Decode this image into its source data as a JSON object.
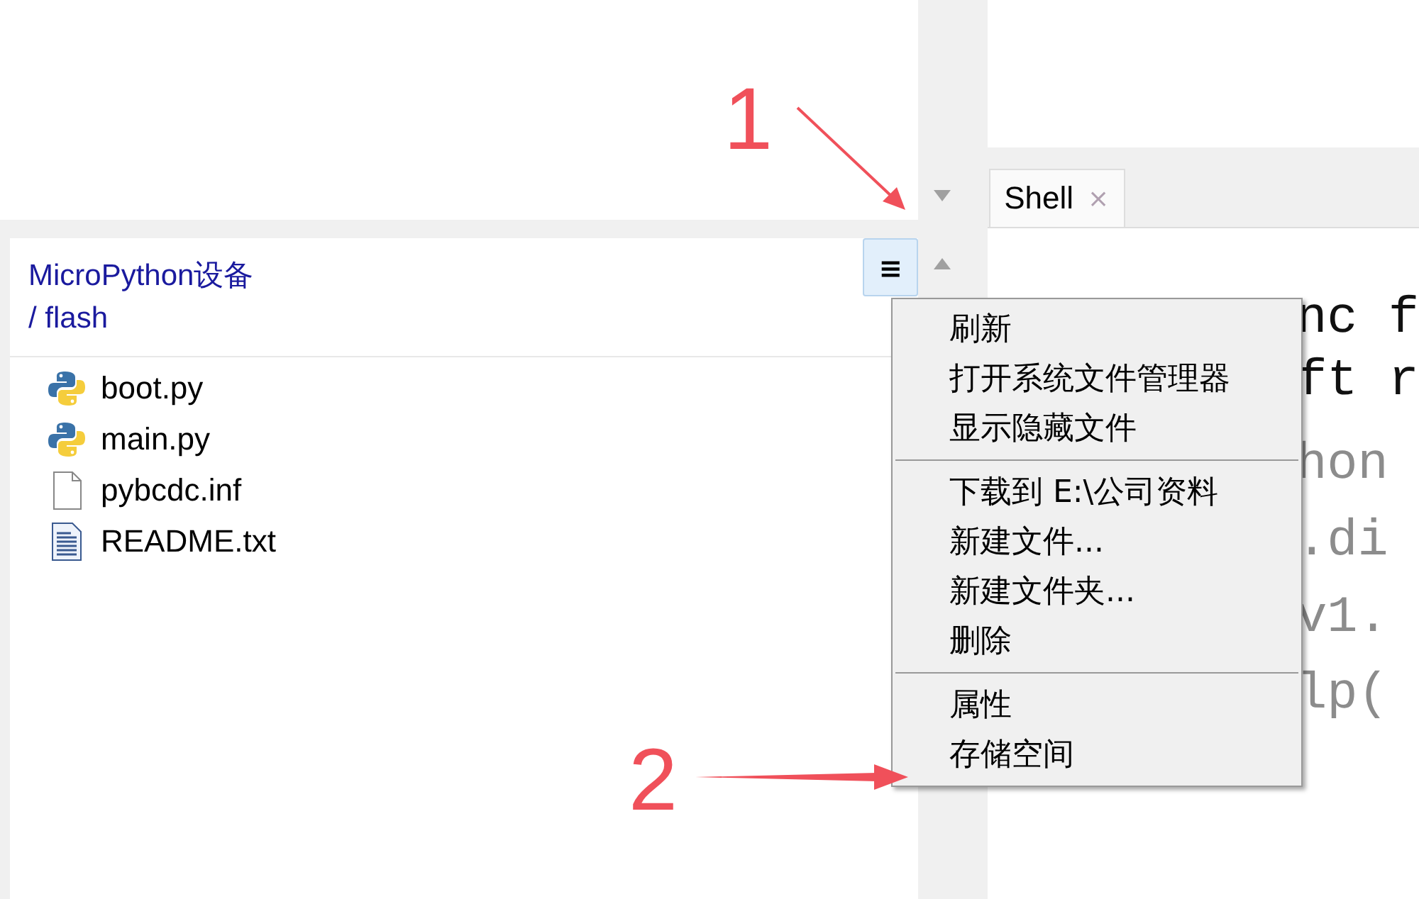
{
  "files_panel": {
    "device": "MicroPython设备",
    "path": "/ flash",
    "files": [
      {
        "name": "boot.py",
        "kind": "python"
      },
      {
        "name": "main.py",
        "kind": "python"
      },
      {
        "name": "pybcdc.inf",
        "kind": "blank"
      },
      {
        "name": "README.txt",
        "kind": "text"
      }
    ],
    "menu_button": {
      "label": "≡",
      "selected": true
    }
  },
  "shell": {
    "tab": {
      "label": "Shell",
      "close": "×"
    },
    "lines": [
      {
        "text": "nc f",
        "dim": false
      },
      {
        "text": "ft r",
        "dim": false
      },
      {
        "text": "hon",
        "dim": true
      },
      {
        "text": ".di",
        "dim": true
      },
      {
        "text": "v1.",
        "dim": true
      },
      {
        "text": "lp(",
        "dim": true
      }
    ]
  },
  "context_menu": {
    "groups": [
      [
        "刷新",
        "打开系统文件管理器",
        "显示隐藏文件"
      ],
      [
        "下载到 E:\\公司资料",
        "新建文件...",
        "新建文件夹...",
        "删除"
      ],
      [
        "属性",
        "存储空间"
      ]
    ]
  },
  "annotations": [
    {
      "label": "1"
    },
    {
      "label": "2"
    }
  ]
}
